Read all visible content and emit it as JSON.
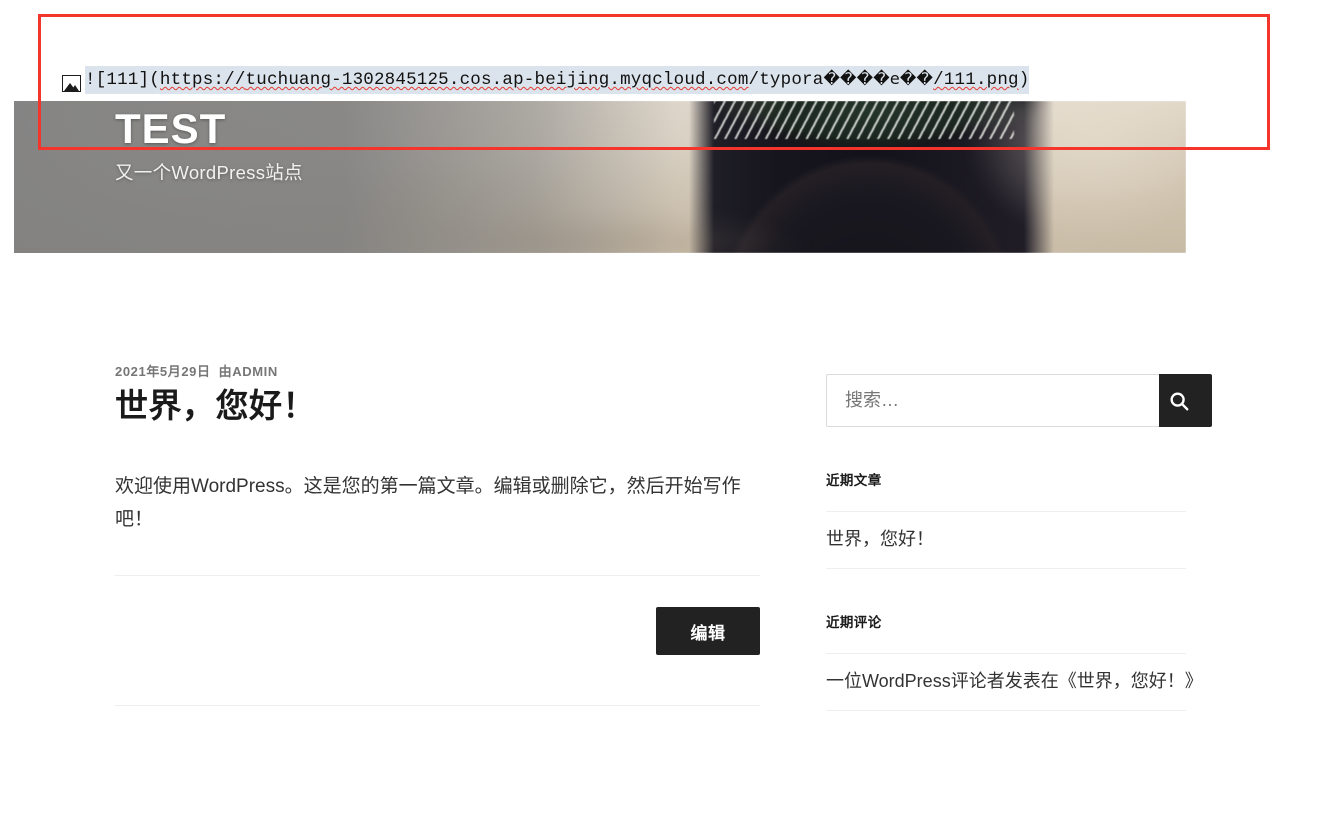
{
  "editor": {
    "markdown_prefix": "![111](",
    "markdown_suffix": ")",
    "url_scheme": "https://",
    "url_host": "tuchuang-1302845125.cos.ap-beijing.myqcloud.com",
    "url_path_prefix": "/typora",
    "url_path_mojibake": "����e��",
    "url_path_file": "/111.png",
    "full_text": "![111](https://tuchuang-1302845125.cos.ap-beijing.myqcloud.com/typora����e��/111.png)",
    "image_icon": "broken-image-icon",
    "selection_highlight_color": "#dbe3ec",
    "spellcheck_underline_color": "#e23b30"
  },
  "annotation": {
    "box_color": "#f5352b",
    "box_label": "red-highlight-rectangle"
  },
  "site": {
    "title": "TEST",
    "description": "又一个WordPress站点"
  },
  "post": {
    "date": "2021年5月29日",
    "byline": "由ADMIN",
    "title": "世界，您好！",
    "content": "欢迎使用WordPress。这是您的第一篇文章。编辑或删除它，然后开始写作吧！",
    "edit_label": "编辑"
  },
  "sidebar": {
    "search": {
      "placeholder": "搜索…",
      "value": "",
      "submit_icon": "search-icon"
    },
    "widgets": [
      {
        "title": "近期文章",
        "items": [
          {
            "text": "世界，您好！"
          }
        ]
      },
      {
        "title": "近期评论",
        "items": [
          {
            "text": "一位WordPress评论者发表在《世界，您好！》"
          }
        ]
      }
    ]
  },
  "colors": {
    "accent_dark": "#222222",
    "annotation_red": "#f5352b",
    "divider": "#eceef0",
    "muted_text": "#767676"
  }
}
